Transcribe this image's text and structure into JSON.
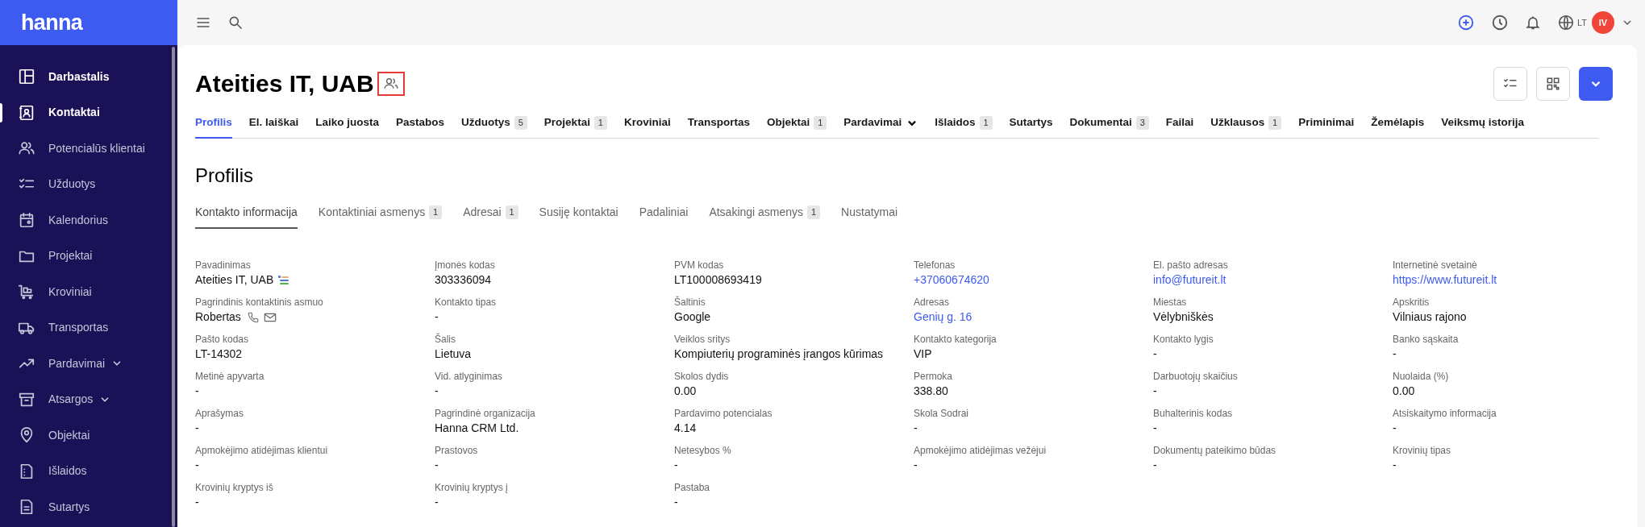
{
  "brand": "hanna",
  "sidebar": {
    "items": [
      {
        "label": "Darbastalis",
        "selected": false,
        "emphasized": true
      },
      {
        "label": "Kontaktai",
        "selected": true,
        "emphasized": true
      },
      {
        "label": "Potencialūs klientai",
        "selected": false,
        "emphasized": false
      },
      {
        "label": "Užduotys",
        "selected": false,
        "emphasized": false
      },
      {
        "label": "Kalendorius",
        "selected": false,
        "emphasized": false
      },
      {
        "label": "Projektai",
        "selected": false,
        "emphasized": false
      },
      {
        "label": "Kroviniai",
        "selected": false,
        "emphasized": false
      },
      {
        "label": "Transportas",
        "selected": false,
        "emphasized": false
      },
      {
        "label": "Pardavimai",
        "selected": false,
        "emphasized": false,
        "expanded": false
      },
      {
        "label": "Atsargos",
        "selected": false,
        "emphasized": false,
        "expanded": false
      },
      {
        "label": "Objektai",
        "selected": false,
        "emphasized": false
      },
      {
        "label": "Išlaidos",
        "selected": false,
        "emphasized": false
      },
      {
        "label": "Sutartys",
        "selected": false,
        "emphasized": false
      }
    ]
  },
  "header": {
    "language": "LT",
    "avatar_initials": "IV"
  },
  "page": {
    "title": "Ateities IT, UAB",
    "tabs": [
      {
        "label": "Profilis",
        "selected": true
      },
      {
        "label": "El. laiškai",
        "selected": false
      },
      {
        "label": "Laiko juosta",
        "selected": false
      },
      {
        "label": "Pastabos",
        "selected": false
      },
      {
        "label": "Užduotys",
        "selected": false,
        "count": "5"
      },
      {
        "label": "Projektai",
        "selected": false,
        "count": "1"
      },
      {
        "label": "Kroviniai",
        "selected": false
      },
      {
        "label": "Transportas",
        "selected": false
      },
      {
        "label": "Objektai",
        "selected": false,
        "count": "1"
      },
      {
        "label": "Pardavimai",
        "selected": false,
        "dropdown": true
      },
      {
        "label": "Išlaidos",
        "selected": false,
        "count": "1"
      },
      {
        "label": "Sutartys",
        "selected": false
      },
      {
        "label": "Dokumentai",
        "selected": false,
        "count": "3"
      },
      {
        "label": "Failai",
        "selected": false
      },
      {
        "label": "Užklausos",
        "selected": false,
        "count": "1"
      },
      {
        "label": "Priminimai",
        "selected": false
      },
      {
        "label": "Žemėlapis",
        "selected": false
      },
      {
        "label": "Veiksmų istorija",
        "selected": false
      }
    ],
    "section_title": "Profilis",
    "subtabs": [
      {
        "label": "Kontakto informacija",
        "selected": true
      },
      {
        "label": "Kontaktiniai asmenys",
        "selected": false,
        "count": "1"
      },
      {
        "label": "Adresai",
        "selected": false,
        "count": "1"
      },
      {
        "label": "Susiję kontaktai",
        "selected": false
      },
      {
        "label": "Padaliniai",
        "selected": false
      },
      {
        "label": "Atsakingi asmenys",
        "selected": false,
        "count": "1"
      },
      {
        "label": "Nustatymai",
        "selected": false
      }
    ],
    "fields": [
      {
        "label": "Pavadinimas",
        "value": "Ateities IT, UAB",
        "kind": "flag"
      },
      {
        "label": "Įmonės kodas",
        "value": "303336094",
        "kind": "text"
      },
      {
        "label": "PVM kodas",
        "value": "LT100008693419",
        "kind": "text"
      },
      {
        "label": "Telefonas",
        "value": "+37060674620",
        "kind": "link"
      },
      {
        "label": "El. pašto adresas",
        "value": "info@futureit.lt",
        "kind": "link"
      },
      {
        "label": "Internetinė svetainė",
        "value": "https://www.futureit.lt",
        "kind": "link"
      },
      {
        "label": "Pagrindinis kontaktinis asmuo",
        "value": "Robertas",
        "kind": "person"
      },
      {
        "label": "Kontakto tipas",
        "value": "-",
        "kind": "text"
      },
      {
        "label": "Šaltinis",
        "value": "Google",
        "kind": "text"
      },
      {
        "label": "Adresas",
        "value": "Genių g. 16",
        "kind": "link"
      },
      {
        "label": "Miestas",
        "value": "Vėlybniškės",
        "kind": "text"
      },
      {
        "label": "Apskritis",
        "value": "Vilniaus rajono",
        "kind": "text"
      },
      {
        "label": "Pašto kodas",
        "value": "LT-14302",
        "kind": "text"
      },
      {
        "label": "Šalis",
        "value": "Lietuva",
        "kind": "text"
      },
      {
        "label": "Veiklos sritys",
        "value": "Kompiuterių programinės įrangos kūrimas",
        "kind": "text"
      },
      {
        "label": "Kontakto kategorija",
        "value": "VIP",
        "kind": "text"
      },
      {
        "label": "Kontakto lygis",
        "value": "-",
        "kind": "text"
      },
      {
        "label": "Banko sąskaita",
        "value": "-",
        "kind": "text"
      },
      {
        "label": "Metinė apyvarta",
        "value": "-",
        "kind": "text"
      },
      {
        "label": "Vid. atlyginimas",
        "value": "-",
        "kind": "text"
      },
      {
        "label": "Skolos dydis",
        "value": "0.00",
        "kind": "text"
      },
      {
        "label": "Permoka",
        "value": "338.80",
        "kind": "text"
      },
      {
        "label": "Darbuotojų skaičius",
        "value": "-",
        "kind": "text"
      },
      {
        "label": "Nuolaida (%)",
        "value": "0.00",
        "kind": "text"
      },
      {
        "label": "Aprašymas",
        "value": "-",
        "kind": "text"
      },
      {
        "label": "Pagrindinė organizacija",
        "value": "Hanna CRM Ltd.",
        "kind": "text"
      },
      {
        "label": "Pardavimo potencialas",
        "value": "4.14",
        "kind": "text"
      },
      {
        "label": "Skola Sodrai",
        "value": "-",
        "kind": "text"
      },
      {
        "label": "Buhalterinis kodas",
        "value": "-",
        "kind": "text"
      },
      {
        "label": "Atsiskaitymo informacija",
        "value": "-",
        "kind": "text"
      },
      {
        "label": "Apmokėjimo atidėjimas klientui",
        "value": "-",
        "kind": "text"
      },
      {
        "label": "Prastovos",
        "value": "-",
        "kind": "text"
      },
      {
        "label": "Netesybos %",
        "value": "-",
        "kind": "text"
      },
      {
        "label": "Apmokėjimo atidėjimas vežėjui",
        "value": "-",
        "kind": "text"
      },
      {
        "label": "Dokumentų pateikimo būdas",
        "value": "-",
        "kind": "text"
      },
      {
        "label": "Krovinių tipas",
        "value": "-",
        "kind": "text"
      },
      {
        "label": "Krovinių kryptys iš",
        "value": "-",
        "kind": "text"
      },
      {
        "label": "Krovinių kryptys į",
        "value": "-",
        "kind": "text"
      },
      {
        "label": "Pastaba",
        "value": "-",
        "kind": "text"
      }
    ]
  }
}
